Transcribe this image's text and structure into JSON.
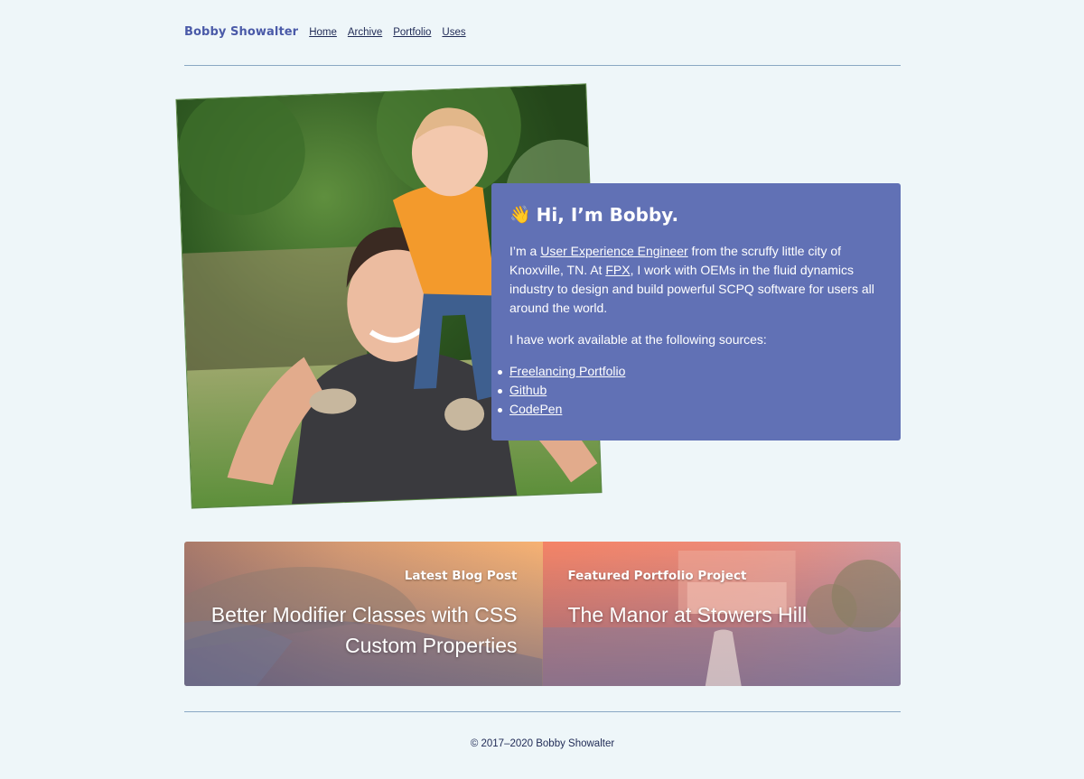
{
  "header": {
    "brand": "Bobby Showalter",
    "nav": [
      "Home",
      "Archive",
      "Portfolio",
      "Uses"
    ]
  },
  "intro": {
    "wave": "👋",
    "title": "Hi, I’m Bobby.",
    "p1_before": "I’m a ",
    "p1_link1": "User Experience Engineer",
    "p1_mid1": " from the scruffy little city of Knoxville, TN. At ",
    "p1_link2": "FPX",
    "p1_after": ", I work with OEMs in the fluid dynamics industry to design and build powerful SCPQ software for users all around the world.",
    "p2": "I have work available at the following sources:",
    "sources": [
      "Freelancing Portfolio",
      "Github",
      "CodePen"
    ]
  },
  "features": {
    "blog_eyebrow": "Latest Blog Post",
    "blog_title": "Better Modifier Classes with CSS Custom Properties",
    "project_eyebrow": "Featured Portfolio Project",
    "project_title": "The Manor at Stowers Hill"
  },
  "footer": {
    "copyright": "© 2017–2020 Bobby Showalter"
  },
  "colors": {
    "background": "#eef6f9",
    "brand": "#4a5aa8",
    "card": "#6171b5",
    "rule": "#8aa8c4"
  }
}
